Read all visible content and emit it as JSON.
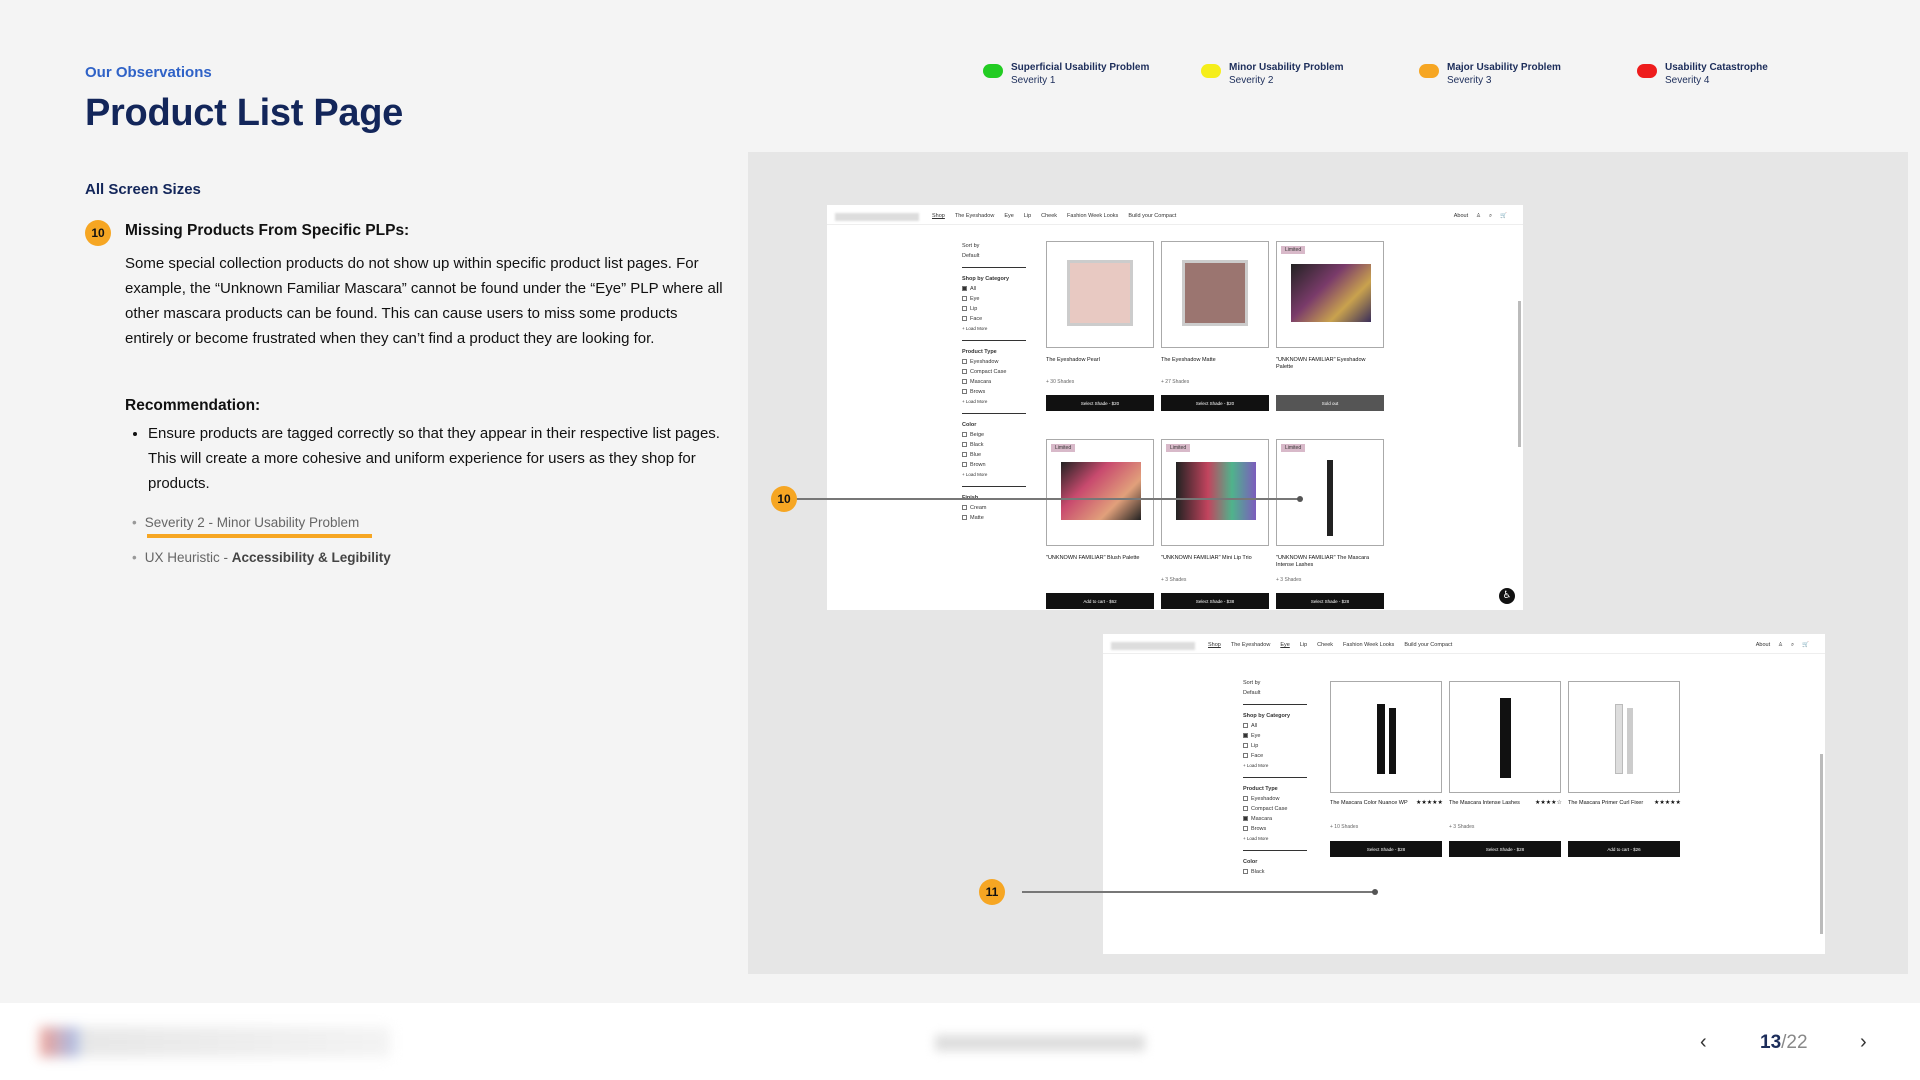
{
  "header": {
    "eyebrow": "Our Observations",
    "title": "Product List Page"
  },
  "legend": [
    {
      "label": "Superficial Usability Problem",
      "severity": "Severity 1",
      "color": "#22cc22"
    },
    {
      "label": "Minor Usability Problem",
      "severity": "Severity 2",
      "color": "#f5ee1a"
    },
    {
      "label": "Major Usability Problem",
      "severity": "Severity 3",
      "color": "#f6a623"
    },
    {
      "label": "Usability Catastrophe",
      "severity": "Severity 4",
      "color": "#ee1c1c"
    }
  ],
  "section": "All Screen Sizes",
  "issue": {
    "number": "10",
    "title": "Missing Products From Specific PLPs:",
    "body": "Some special collection products do not show up within specific product list pages. For example, the “Unknown Familiar Mascara” cannot be found under the “Eye” PLP where all other mascara products can be found. This can cause users to miss some products entirely or become frustrated when they can’t find a product they are looking for.",
    "recommendation_title": "Recommendation:",
    "recommendation": "Ensure products are tagged correctly so that they appear in their respective list pages. This will create a more cohesive and uniform experience for users as they shop for products.",
    "severity_link": "Severity 2 - Minor Usability Problem",
    "heuristic_prefix": "UX Heuristic - ",
    "heuristic": "Accessibility & Legibility"
  },
  "shot1": {
    "nav": [
      "Shop",
      "The Eyeshadow",
      "Eye",
      "Lip",
      "Cheek",
      "Fashion Week Looks",
      "Build your Compact"
    ],
    "nav_right": [
      "About"
    ],
    "sort_label": "Sort by",
    "sort_value": "Default",
    "filters": [
      {
        "heading": "Shop by Category",
        "options": [
          "All",
          "Eye",
          "Lip",
          "Face"
        ],
        "checked": 0
      },
      {
        "heading": "Product Type",
        "options": [
          "Eyeshadow",
          "Compact Case",
          "Mascara",
          "Brows"
        ],
        "checked": -1
      },
      {
        "heading": "Color",
        "options": [
          "Beige",
          "Black",
          "Blue",
          "Brown"
        ],
        "checked": -1
      },
      {
        "heading": "Finish",
        "options": [
          "Cream",
          "Matte"
        ],
        "checked": -1
      }
    ],
    "load_more": "+ Load More",
    "products": [
      {
        "name": "The Eyeshadow Pearl",
        "shades": "+ 30 Shades",
        "button": "Select Shade - $20",
        "limited": ""
      },
      {
        "name": "The Eyeshadow Matte",
        "shades": "+ 27 Shades",
        "button": "Select Shade - $20",
        "limited": ""
      },
      {
        "name": "\"UNKNOWN FAMILIAR\" Eyeshadow Palette",
        "shades": "",
        "button": "Sold out",
        "limited": "Limited"
      },
      {
        "name": "\"UNKNOWN FAMILIAR\" Blush Palette",
        "shades": "",
        "button": "Add to cart - $62",
        "limited": "Limited"
      },
      {
        "name": "\"UNKNOWN FAMILIAR\" Mini Lip Trio",
        "shades": "+ 3 Shades",
        "button": "Select Shade - $38",
        "limited": "Limited"
      },
      {
        "name": "\"UNKNOWN FAMILIAR\" The Mascara Intense Lashes",
        "shades": "+ 3 Shades",
        "button": "Select Shade - $28",
        "limited": "Limited"
      }
    ]
  },
  "shot2": {
    "nav": [
      "Shop",
      "The Eyeshadow",
      "Eye",
      "Lip",
      "Cheek",
      "Fashion Week Looks",
      "Build your Compact"
    ],
    "nav_right": [
      "About"
    ],
    "sort_label": "Sort by",
    "sort_value": "Default",
    "filters": [
      {
        "heading": "Shop by Category",
        "options": [
          "All",
          "Eye",
          "Lip",
          "Face"
        ],
        "checked": 1
      },
      {
        "heading": "Product Type",
        "options": [
          "Eyeshadow",
          "Compact Case",
          "Mascara",
          "Brows"
        ],
        "checked": 2
      },
      {
        "heading": "Color",
        "options": [
          "Black"
        ],
        "checked": -1
      }
    ],
    "load_more": "+ Load More",
    "products": [
      {
        "name": "The Mascara Color Nuance WP",
        "shades": "+ 10 Shades",
        "button": "Select Shade - $28",
        "stars": "★★★★★"
      },
      {
        "name": "The Mascara Intense Lashes",
        "shades": "+ 3 Shades",
        "button": "Select Shade - $28",
        "stars": "★★★★☆"
      },
      {
        "name": "The Mascara Primer Curl Fixer",
        "shades": "",
        "button": "Add to cart - $26",
        "stars": "★★★★★"
      }
    ]
  },
  "callouts": [
    {
      "number": "10"
    },
    {
      "number": "11"
    }
  ],
  "footer": {
    "page_current": "13",
    "page_total": "/22"
  }
}
